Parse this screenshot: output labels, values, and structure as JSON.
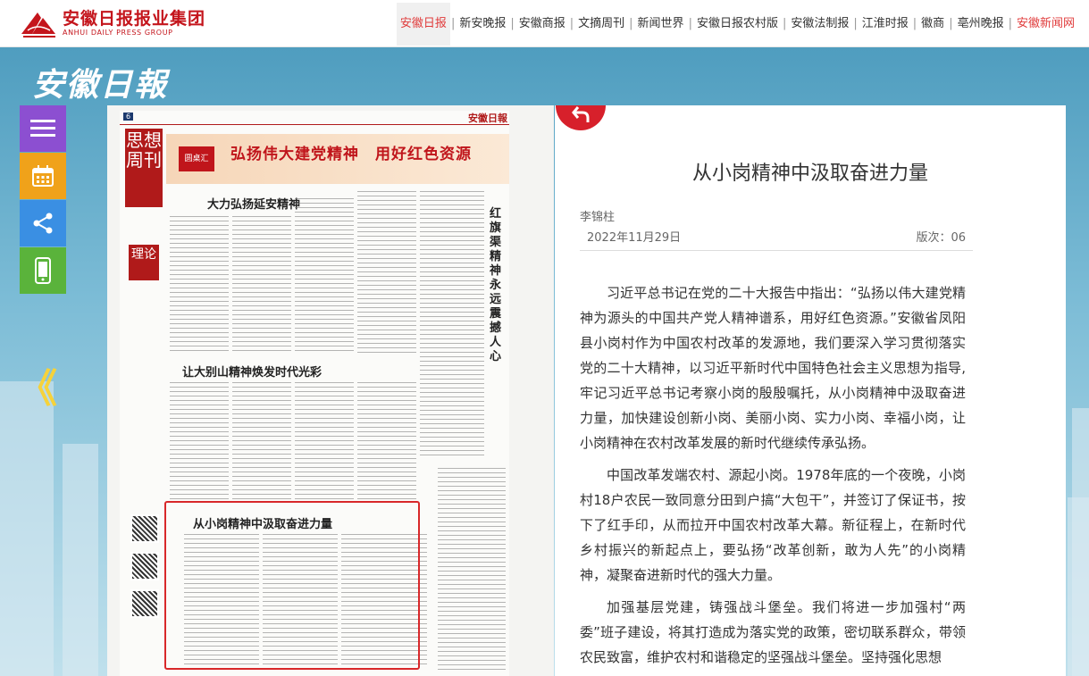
{
  "group": {
    "name": "安徽日报报业集团",
    "name_en": "ANHUI DAILY PRESS GROUP"
  },
  "nav": [
    {
      "label": "安徽日报",
      "active": true
    },
    {
      "label": "新安晚报"
    },
    {
      "label": "安徽商报"
    },
    {
      "label": "文摘周刊"
    },
    {
      "label": "新闻世界"
    },
    {
      "label": "安徽日报农村版"
    },
    {
      "label": "安徽法制报"
    },
    {
      "label": "江淮时报"
    },
    {
      "label": "徽商"
    },
    {
      "label": "亳州晚报"
    },
    {
      "label": "安徽新闻网",
      "red": true
    }
  ],
  "paper_logo": "安徽日報",
  "tools": {
    "menu": "menu-icon",
    "calendar": "calendar-icon",
    "share": "share-icon",
    "mobile": "mobile-icon"
  },
  "nav_arrows": {
    "prev": "《",
    "next": "》"
  },
  "page_image": {
    "page_number": "6",
    "paper_name": "安徽日報",
    "section": "思想周刊",
    "subsection": "理论",
    "banner_tag": "圆桌汇",
    "banner_title": "弘扬伟大建党精神　用好红色资源",
    "headline_1": "大力弘扬延安精神",
    "headline_2": "让大别山精神焕发时代光彩",
    "headline_3": "红旗渠精神永远震撼人心",
    "highlight_title": "从小岗精神中汲取奋进力量"
  },
  "article": {
    "title": "从小岗精神中汲取奋进力量",
    "author": "李锦柱",
    "date": "2022年11月29日",
    "edition": "版次：06",
    "paragraphs": [
      "习近平总书记在党的二十大报告中指出：“弘扬以伟大建党精神为源头的中国共产党人精神谱系，用好红色资源。”安徽省凤阳县小岗村作为中国农村改革的发源地，我们要深入学习贯彻落实党的二十大精神，以习近平新时代中国特色社会主义思想为指导,牢记习近平总书记考察小岗的殷殷嘱托，从小岗精神中汲取奋进力量，加快建设创新小岗、美丽小岗、实力小岗、幸福小岗，让小岗精神在农村改革发展的新时代继续传承弘扬。",
      "中国改革发端农村、源起小岗。1978年底的一个夜晚，小岗村18户农民一致同意分田到户搞“大包干”，并签订了保证书，按下了红手印，从而拉开中国农村改革大幕。新征程上，在新时代乡村振兴的新起点上，要弘扬“改革创新，敢为人先”的小岗精神，凝聚奋进新时代的强大力量。",
      "加强基层党建，铸强战斗堡垒。我们将进一步加强村“两委”班子建设，将其打造成为落实党的政策，密切联系群众，带领农民致富，维护农村和谐稳定的坚强战斗堡垒。坚持强化思想"
    ]
  }
}
